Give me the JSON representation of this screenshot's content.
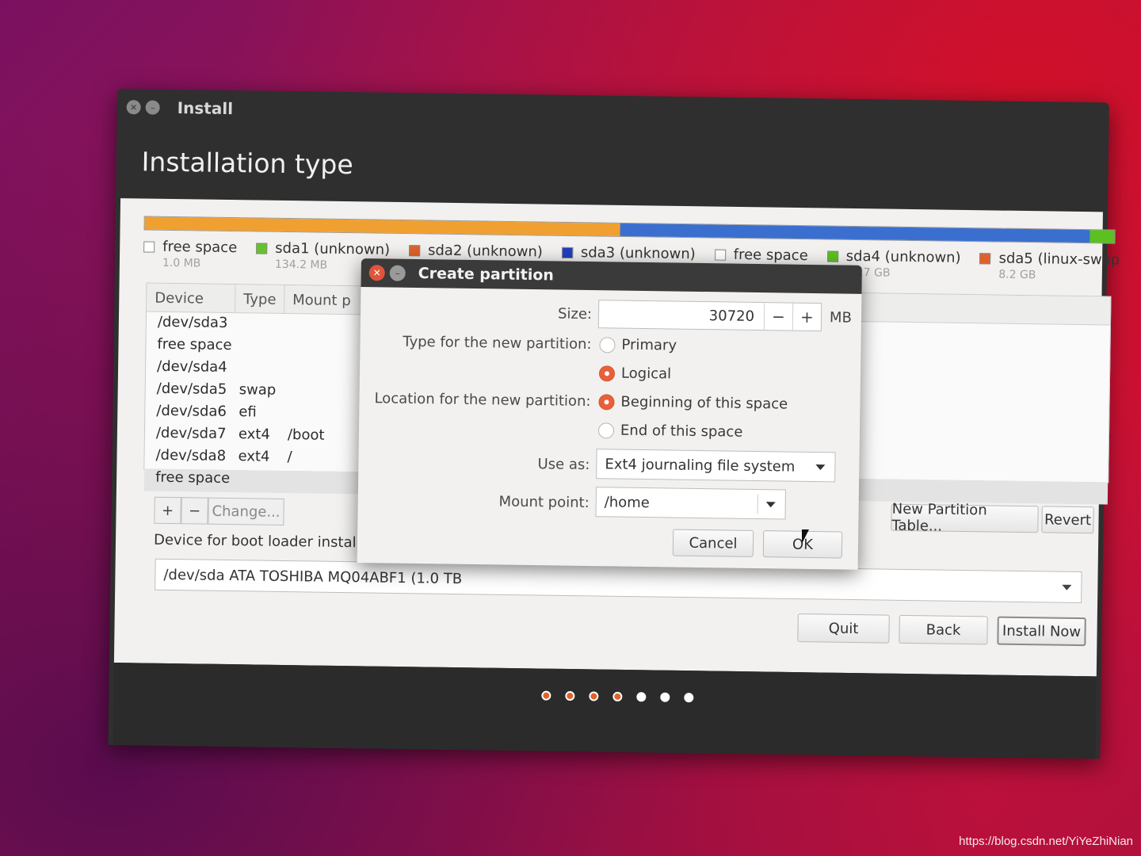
{
  "window": {
    "title": "Install",
    "header": "Installation type"
  },
  "partition_bar": {
    "segments": [
      {
        "color": "#f0a030",
        "fraction": 0.49
      },
      {
        "color": "#3a6fd0",
        "fraction": 0.485
      },
      {
        "color": "#5cc020",
        "fraction": 0.025
      }
    ]
  },
  "legend": [
    {
      "label": "free space",
      "size": "1.0 MB",
      "color": "#ffffff"
    },
    {
      "label": "sda1 (unknown)",
      "size": "134.2 MB",
      "color": "#66c22c"
    },
    {
      "label": "sda2 (unknown)",
      "size": "",
      "color": "#e0622a"
    },
    {
      "label": "sda3 (unknown)",
      "size": "",
      "color": "#1f3fbf"
    },
    {
      "label": "free space",
      "size": "",
      "color": "#ffffff"
    },
    {
      "label": "sda4 (unknown)",
      "size": "38.7 GB",
      "color": "#5cc020"
    },
    {
      "label": "sda5 (linux-swap",
      "size": "8.2 GB",
      "color": "#e0622a"
    }
  ],
  "table": {
    "headers": [
      "Device",
      "Type",
      "Mount p"
    ],
    "rows": [
      {
        "device": "/dev/sda3",
        "type": "",
        "mount": ""
      },
      {
        "device": "free space",
        "type": "",
        "mount": ""
      },
      {
        "device": "/dev/sda4",
        "type": "",
        "mount": ""
      },
      {
        "device": "/dev/sda5",
        "type": "swap",
        "mount": ""
      },
      {
        "device": "/dev/sda6",
        "type": "efi",
        "mount": ""
      },
      {
        "device": "/dev/sda7",
        "type": "ext4",
        "mount": "/boot"
      },
      {
        "device": "/dev/sda8",
        "type": "ext4",
        "mount": "/"
      },
      {
        "device": "free space",
        "type": "",
        "mount": ""
      }
    ]
  },
  "table_toolbar": {
    "add": "+",
    "remove": "−",
    "change": "Change...",
    "new_table": "New Partition Table...",
    "revert": "Revert"
  },
  "bootloader": {
    "label": "Device for boot loader instal",
    "value": "/dev/sda   ATA TOSHIBA MQ04ABF1 (1.0 TB"
  },
  "buttons": {
    "quit": "Quit",
    "back": "Back",
    "install": "Install Now"
  },
  "progress_dots": {
    "total": 7,
    "done": 4,
    "done_color": "#e0622a",
    "todo_color": "#ffffff"
  },
  "dialog": {
    "title": "Create partition",
    "size_label": "Size:",
    "size_value": "30720",
    "size_minus": "−",
    "size_plus": "+",
    "size_unit": "MB",
    "type_label": "Type for the new partition:",
    "type_primary": "Primary",
    "type_logical": "Logical",
    "location_label": "Location for the new partition:",
    "loc_begin": "Beginning of this space",
    "loc_end": "End of this space",
    "use_label": "Use as:",
    "use_value": "Ext4 journaling file system",
    "mount_label": "Mount point:",
    "mount_value": "/home",
    "cancel": "Cancel",
    "ok": "OK"
  },
  "watermark": "https://blog.csdn.net/YiYeZhiNian"
}
